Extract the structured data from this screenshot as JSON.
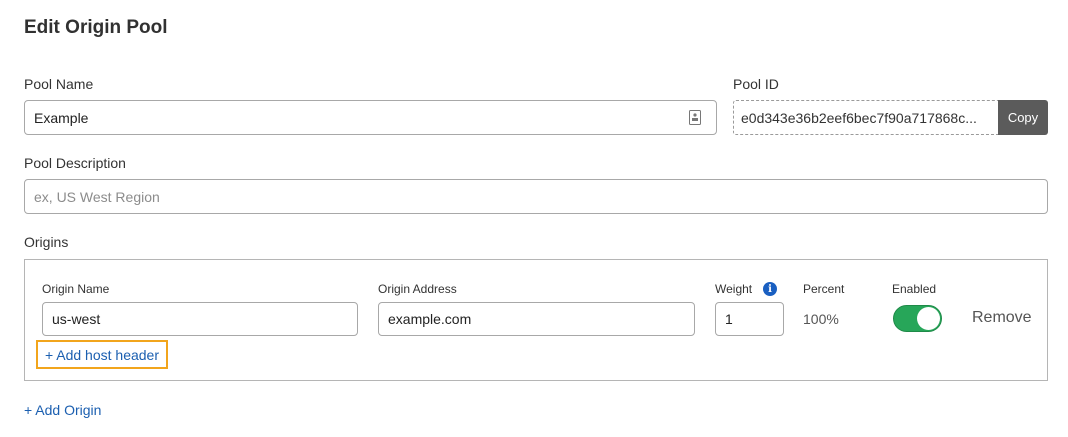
{
  "page": {
    "title": "Edit Origin Pool"
  },
  "pool_name": {
    "label": "Pool Name",
    "value": "Example",
    "icon": "contact-card-icon"
  },
  "pool_id": {
    "label": "Pool ID",
    "value": "e0d343e36b2eef6bec7f90a717868c...",
    "copy_label": "Copy"
  },
  "pool_description": {
    "label": "Pool Description",
    "placeholder": "ex, US West Region"
  },
  "origins": {
    "label": "Origins",
    "columns": {
      "name": "Origin Name",
      "address": "Origin Address",
      "weight": "Weight",
      "percent": "Percent",
      "enabled": "Enabled"
    },
    "rows": [
      {
        "name": "us-west",
        "address": "example.com",
        "weight": "1",
        "percent": "100%",
        "enabled": true,
        "remove_label": "Remove",
        "add_host_header_label": "+ Add host header"
      }
    ],
    "add_origin_label": "+ Add Origin"
  },
  "colors": {
    "link": "#1b5fb0",
    "toggle_on": "#27a659",
    "highlight": "#f2a51c",
    "copy_button": "#5b5b5b"
  }
}
